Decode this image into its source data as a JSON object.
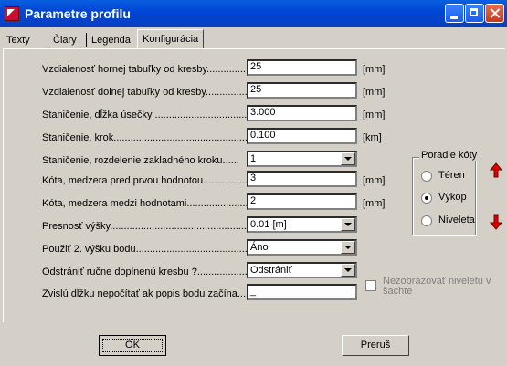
{
  "window": {
    "title": "Parametre profilu"
  },
  "tabs": [
    "Texty",
    "Čiary",
    "Legenda",
    "Konfigurácia"
  ],
  "rows": [
    {
      "label": "Vzdialenosť hornej tabuľky od kresby.........................",
      "value": "25",
      "unit": "[mm]",
      "kind": "text"
    },
    {
      "label": "Vzdialenosť dolnej tabuľky od kresby...........................",
      "value": "25",
      "unit": "[mm]",
      "kind": "text"
    },
    {
      "label": "Staničenie, dĺžka úsečky ...........................................",
      "value": "3.000",
      "unit": "[mm]",
      "kind": "text"
    },
    {
      "label": "Staničenie, krok...............................................................",
      "value": "0.100",
      "unit": "[km]",
      "kind": "text"
    },
    {
      "label": "Staničenie, rozdelenie zakladného kroku......",
      "value": "1",
      "unit": "",
      "kind": "combo"
    },
    {
      "label": "Kóta, medzera pred prvou hodnotou.........................",
      "value": "3",
      "unit": "[mm]",
      "kind": "text"
    },
    {
      "label": "Kóta, medzera medzi hodnotami...............................",
      "value": "2",
      "unit": "[mm]",
      "kind": "text"
    },
    {
      "label": "Presnosť výšky...............................................................",
      "value": "0.01 [m]",
      "unit": "",
      "kind": "combo"
    },
    {
      "label": "Použiť 2. výšku bodu....................................................",
      "value": "Áno",
      "unit": "",
      "kind": "combo"
    },
    {
      "label": "Odstrániť ručne doplnenú kresbu ?......................",
      "value": "Odstrániť",
      "unit": "",
      "kind": "combo"
    },
    {
      "label": "Zvislú dĺžku nepočítať ak popis bodu začína.....",
      "value": "_",
      "unit": "",
      "kind": "text"
    }
  ],
  "poradie": {
    "title": "Poradie kóty",
    "options": [
      "Téren",
      "Výkop",
      "Niveleta"
    ],
    "selected": "Výkop"
  },
  "checkbox": {
    "label": "Nezobrazovať niveletu v šachte",
    "checked": false
  },
  "buttons": {
    "ok": "OK",
    "cancel": "Preruš"
  },
  "icons": {
    "up": "red-up-arrow-icon",
    "down": "red-down-arrow-icon"
  }
}
